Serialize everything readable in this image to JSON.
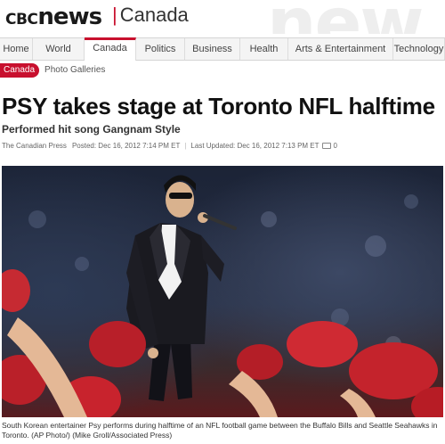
{
  "header": {
    "logo_cbc": "CBC",
    "logo_news": "news",
    "section": "Canada",
    "background_word": "new"
  },
  "nav": {
    "tabs": [
      {
        "label": "Home",
        "width": 37
      },
      {
        "label": "World",
        "width": 58
      },
      {
        "label": "Canada",
        "width": 58,
        "active": true
      },
      {
        "label": "Politics",
        "width": 55
      },
      {
        "label": "Business",
        "width": 62
      },
      {
        "label": "Health",
        "width": 54
      },
      {
        "label": "Arts & Entertainment",
        "width": 118
      },
      {
        "label": "Technology",
        "width": 58
      }
    ]
  },
  "subnav": {
    "section_pill": "Canada",
    "link": "Photo Galleries"
  },
  "article": {
    "headline": "PSY takes stage at Toronto NFL halftime",
    "subhead": "Performed hit song Gangnam Style",
    "source": "The Canadian Press",
    "posted": "Posted: Dec 16, 2012 7:14 PM ET",
    "updated": "Last Updated: Dec 16, 2012 7:13 PM ET",
    "comment_count": "0",
    "caption": "South Korean entertainer Psy performs during halftime of an NFL football game between the Buffalo Bills and Seattle Seahawks in Toronto. (AP Photo/) (Mike Groll/Associated Press)"
  },
  "colors": {
    "accent": "#c8102e"
  }
}
